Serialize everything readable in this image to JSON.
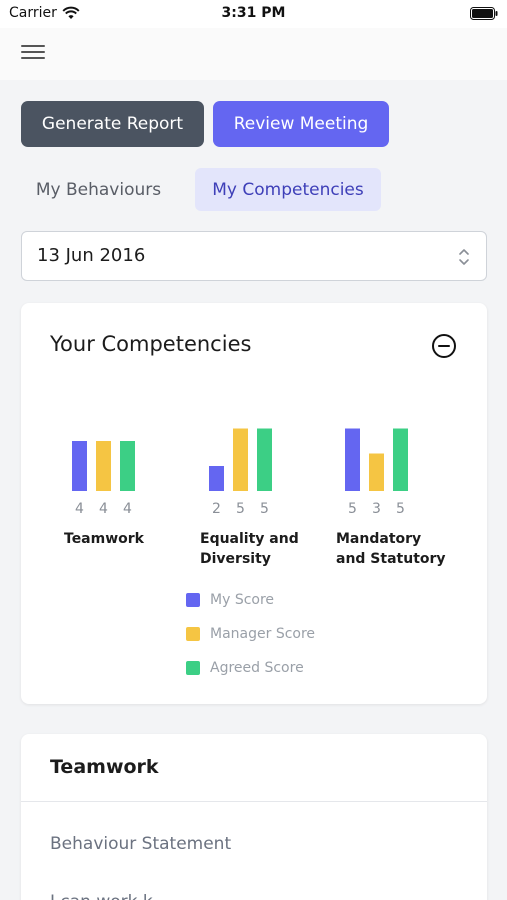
{
  "status_bar": {
    "carrier": "Carrier",
    "time": "3:31 PM"
  },
  "actions": {
    "generate_report": "Generate Report",
    "review_meeting": "Review Meeting"
  },
  "tabs": [
    {
      "label": "My Behaviours",
      "selected": false
    },
    {
      "label": "My Competencies",
      "selected": true
    }
  ],
  "date_select": {
    "value": "13 Jun 2016"
  },
  "competencies_card": {
    "title": "Your Competencies"
  },
  "chart_data": {
    "type": "bar",
    "categories": [
      "Teamwork",
      "Equality and Diversity",
      "Mandatory and Statutory"
    ],
    "series": [
      {
        "name": "My Score",
        "values": [
          4,
          2,
          5
        ],
        "color": "#6466f1"
      },
      {
        "name": "Manager Score",
        "values": [
          4,
          5,
          3
        ],
        "color": "#f5c543"
      },
      {
        "name": "Agreed Score",
        "values": [
          4,
          5,
          5
        ],
        "color": "#3ccf85"
      }
    ],
    "legend": "bottom"
  },
  "chart_labels": {
    "teamwork": "Teamwork",
    "equality_line1": "Equality and",
    "equality_line2": "Diversity",
    "mandatory_line1": "Mandatory",
    "mandatory_line2": "and Statutory"
  },
  "legend": {
    "my_score": "My Score",
    "manager_score": "Manager Score",
    "agreed_score": "Agreed Score"
  },
  "detail_card": {
    "title": "Teamwork",
    "behaviour_statement": "Behaviour Statement",
    "next_text": "I can work k..."
  },
  "colors": {
    "accent": "#6466f1",
    "dark_button": "#4b5461",
    "tab_selected_bg": "#e3e5fb"
  },
  "icons": [
    "wifi-icon",
    "battery-icon",
    "menu-icon",
    "chevrons-icon",
    "collapse-icon"
  ]
}
